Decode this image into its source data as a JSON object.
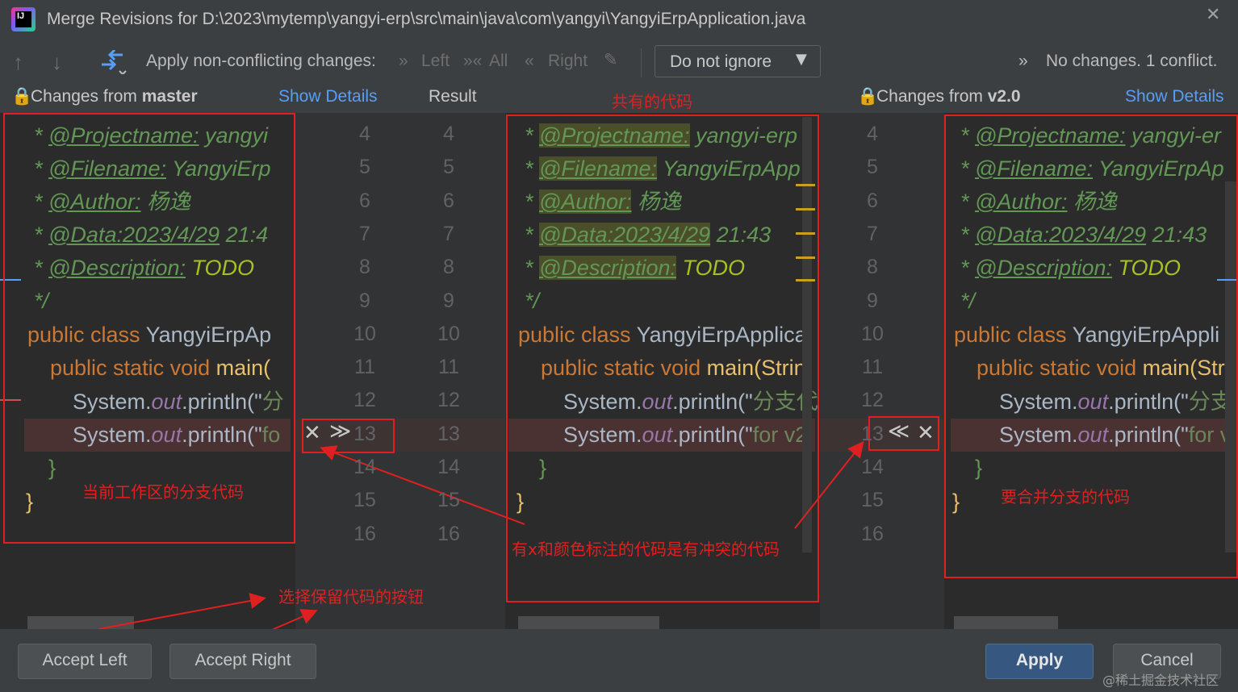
{
  "window": {
    "title": "Merge Revisions for D:\\2023\\mytemp\\yangyi-erp\\src\\main\\java\\com\\yangyi\\YangyiErpApplication.java",
    "app_icon_text": "IJ",
    "close_glyph": "✕"
  },
  "toolbar": {
    "prev_glyph": "↑",
    "next_glyph": "↓",
    "apply_label": "Apply non-conflicting changes:",
    "left_label": "Left",
    "all_label": "All",
    "right_label": "Right",
    "ignore_value": "Do not ignore",
    "status": "No changes. 1 conflict."
  },
  "panes": {
    "left_title_prefix": "Changes from ",
    "left_branch": "master",
    "left_details": "Show Details",
    "center_title": "Result",
    "right_title_prefix": "Changes from ",
    "right_branch": "v2.0",
    "right_details": "Show Details"
  },
  "code": {
    "left": {
      "l4_tag": "@Projectname:",
      "l4_val": " yangyi",
      "l5_tag": "@Filename:",
      "l5_val": " YangyiErp",
      "l6_tag": "@Author:",
      "l6_val": " 杨逸",
      "l7_tag": "@Data:2023/4/29",
      "l7_val": " 21:4",
      "l8_tag": "@Description:",
      "l8_val": " TODO",
      "l10_kw": "public class ",
      "l10_cls": "YangyiErpAp",
      "l11_kw": "public static void ",
      "l11_cls": "main(",
      "l12_a": "System.",
      "l12_b": "out",
      "l12_c": ".println(\"",
      "l12_d": "分",
      "l13_a": "System.",
      "l13_b": "out",
      "l13_c": ".println(\"",
      "l13_d": "fo"
    },
    "center": {
      "l4_tag": "@Projectname:",
      "l4_val": " yangyi-erp",
      "l5_tag": "@Filename:",
      "l5_val": " YangyiErpApp",
      "l6_tag": "@Author:",
      "l6_val": " 杨逸",
      "l7_tag": "@Data:2023/4/29",
      "l7_val": " 21:43",
      "l8_tag": "@Description:",
      "l8_val": " TODO",
      "l10_kw": "public class ",
      "l10_cls": "YangyiErpApplica",
      "l11_kw": "public static void ",
      "l11_cls": "main(Strin",
      "l12_a": "System.",
      "l12_b": "out",
      "l12_c": ".println(\"",
      "l12_d": "分支代",
      "l13_a": "System.",
      "l13_b": "out",
      "l13_c": ".println(\"",
      "l13_d": "for v2"
    },
    "right": {
      "l4_tag": "@Projectname:",
      "l4_val": " yangyi-er",
      "l5_tag": "@Filename:",
      "l5_val": " YangyiErpAp",
      "l6_tag": "@Author:",
      "l6_val": " 杨逸",
      "l7_tag": "@Data:2023/4/29",
      "l7_val": " 21:43",
      "l8_tag": "@Description:",
      "l8_val": " TODO",
      "l10_kw": "public class ",
      "l10_cls": "YangyiErpAppli",
      "l11_kw": "public static void ",
      "l11_cls": "main(Str",
      "l12_a": "System.",
      "l12_b": "out",
      "l12_c": ".println(\"",
      "l12_d": "分支",
      "l13_a": "System.",
      "l13_b": "out",
      "l13_c": ".println(\"",
      "l13_d": "for v"
    },
    "star": "* ",
    "close_comment": "*/",
    "open_brace": "}",
    "line_numbers": [
      "4",
      "5",
      "6",
      "7",
      "8",
      "9",
      "10",
      "11",
      "12",
      "13",
      "14",
      "15",
      "16"
    ]
  },
  "annotations": {
    "common_code": "共有的代码",
    "current_branch": "当前工作区的分支代码",
    "merge_branch": "要合并分支的代码",
    "conflict_note": "有x和颜色标注的代码是有冲突的代码",
    "buttons_note": "选择保留代码的按钮"
  },
  "controls": {
    "reject_glyph": "✕",
    "accept_left_glyph": "≫",
    "accept_right_glyph": "≪"
  },
  "buttons": {
    "accept_left": "Accept Left",
    "accept_right": "Accept Right",
    "apply": "Apply",
    "cancel": "Cancel"
  },
  "watermark": "@稀土掘金技术社区"
}
